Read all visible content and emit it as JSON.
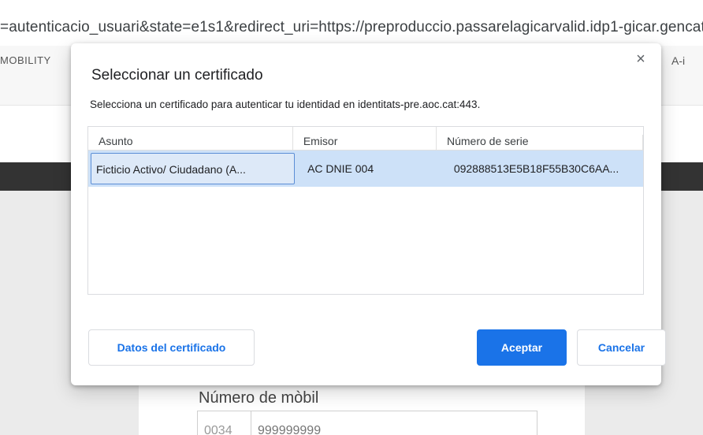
{
  "browser": {
    "url": "=autenticacio_usuari&state=e1s1&redirect_uri=https://preproduccio.passarelagicarvalid.idp1-gicar.gencat.cat",
    "nav_left": "MOBILITY",
    "nav_right": "A-i"
  },
  "page_form": {
    "mobile_label": "Número de mòbil",
    "prefix": "0034",
    "number_placeholder": "999999999"
  },
  "dialog": {
    "title": "Seleccionar un certificado",
    "description": "Selecciona un certificado para autenticar tu identidad en identitats-pre.aoc.cat:443.",
    "close_icon": "×",
    "columns": [
      "Asunto",
      "Emisor",
      "Número de serie"
    ],
    "rows": [
      {
        "subject": "Ficticio Activo/ Ciudadano (A...",
        "issuer": "AC DNIE 004",
        "serial": "092888513E5B18F55B30C6AA..."
      }
    ],
    "buttons": {
      "details": "Datos del certificado",
      "accept": "Aceptar",
      "cancel": "Cancelar"
    }
  },
  "colors": {
    "accent": "#1a73e8",
    "selected_row": "#cde1f8",
    "dark_band": "#333333",
    "page_background": "#ebebeb"
  }
}
